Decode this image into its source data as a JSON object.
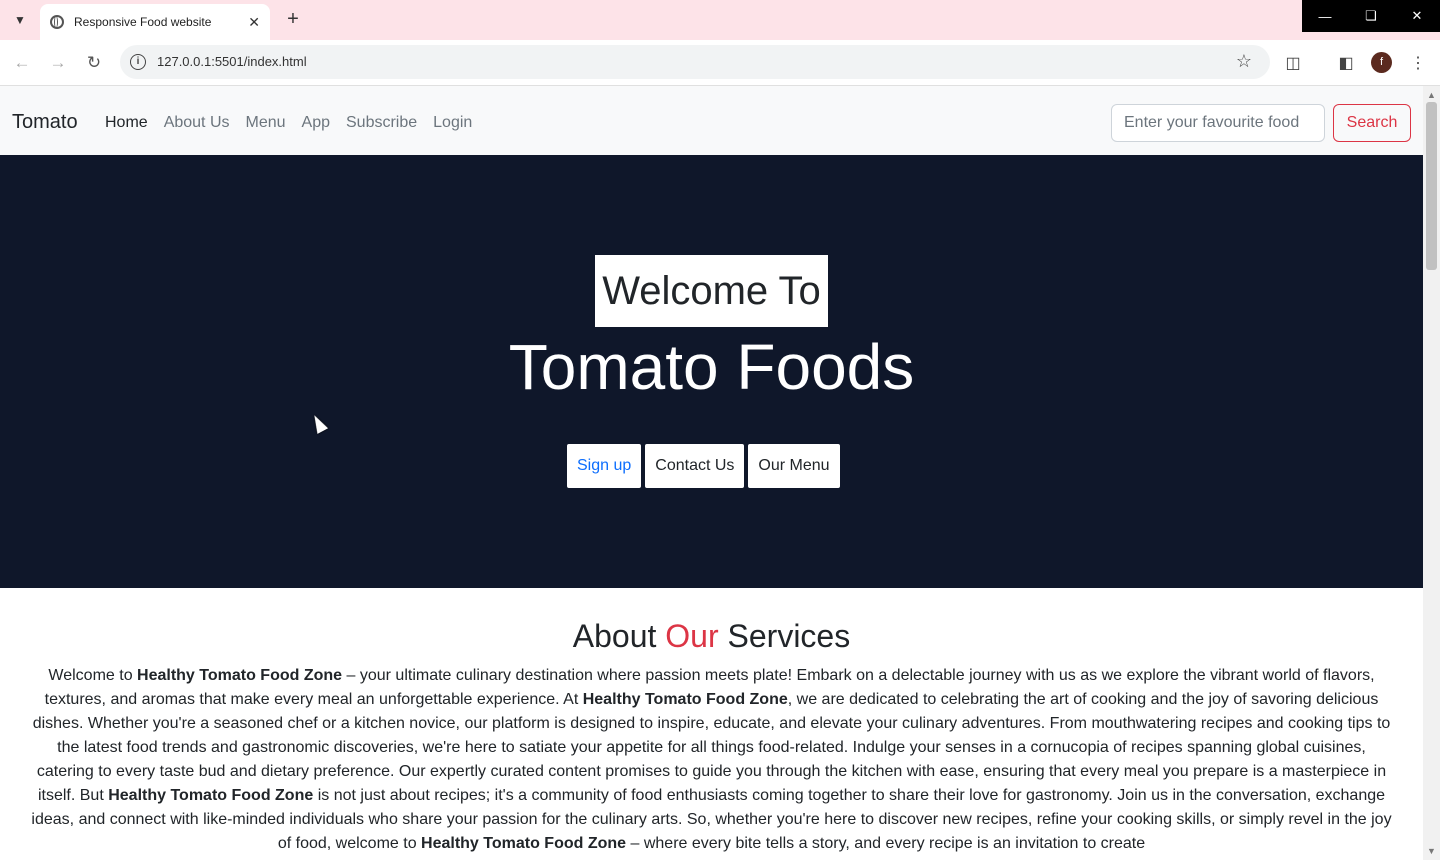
{
  "browser": {
    "tab_title": "Responsive Food website",
    "url": "127.0.0.1:5501/index.html",
    "profile_initial": "f"
  },
  "navbar": {
    "brand": "Tomato",
    "links": [
      "Home",
      "About Us",
      "Menu",
      "App",
      "Subscribe",
      "Login"
    ],
    "active_link": "Home",
    "search_placeholder": "Enter your favourite food",
    "search_button": "Search"
  },
  "hero": {
    "welcome": "Welcome To",
    "title": "Tomato Foods",
    "buttons": [
      "Sign up",
      "Contact Us",
      "Our Menu"
    ]
  },
  "about": {
    "title_prefix": "About ",
    "title_accent": "Our",
    "title_suffix": " Services",
    "brand_name": "Healthy Tomato Food Zone",
    "p1": "Welcome to ",
    "p2": " – your ultimate culinary destination where passion meets plate! Embark on a delectable journey with us as we explore the vibrant world of flavors, textures, and aromas that make every meal an unforgettable experience. At ",
    "p3": ", we are dedicated to celebrating the art of cooking and the joy of savoring delicious dishes. Whether you're a seasoned chef or a kitchen novice, our platform is designed to inspire, educate, and elevate your culinary adventures. From mouthwatering recipes and cooking tips to the latest food trends and gastronomic discoveries, we're here to satiate your appetite for all things food-related. Indulge your senses in a cornucopia of recipes spanning global cuisines, catering to every taste bud and dietary preference. Our expertly curated content promises to guide you through the kitchen with ease, ensuring that every meal you prepare is a masterpiece in itself. But ",
    "p4": " is not just about recipes; it's a community of food enthusiasts coming together to share their love for gastronomy. Join us in the conversation, exchange ideas, and connect with like-minded individuals who share your passion for the culinary arts. So, whether you're here to discover new recipes, refine your cooking skills, or simply revel in the joy of food, welcome to ",
    "p5": " – where every bite tells a story, and every recipe is an invitation to create"
  },
  "colors": {
    "hero_bg": "#0f172a",
    "accent": "#dc3545",
    "tabstrip": "#fde3e8"
  }
}
